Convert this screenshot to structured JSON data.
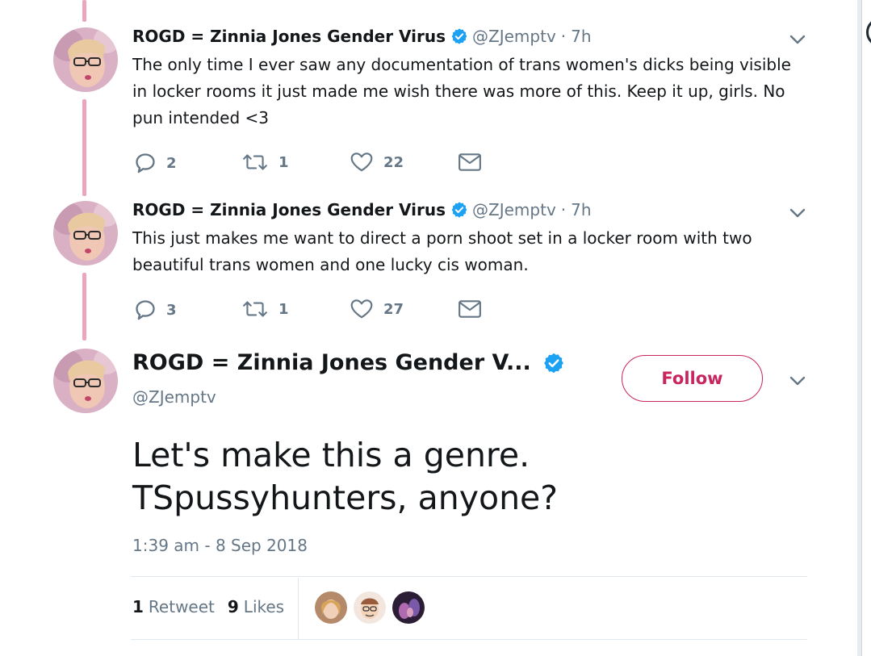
{
  "tweets": [
    {
      "name": "ROGD = Zinnia Jones Gender Virus",
      "handle": "@ZJemptv",
      "time": "7h",
      "text": "The only time I ever saw any documentation of trans women's dicks being visible in locker rooms it just made me wish there was more of this. Keep it up, girls. No pun intended <3",
      "replies": "2",
      "retweets": "1",
      "likes": "22"
    },
    {
      "name": "ROGD = Zinnia Jones Gender Virus",
      "handle": "@ZJemptv",
      "time": "7h",
      "text": "This just makes me want to direct a porn shoot set in a locker room with two beautiful trans women and one lucky cis woman.",
      "replies": "3",
      "retweets": "1",
      "likes": "27"
    }
  ],
  "main_tweet": {
    "name": "ROGD = Zinnia Jones Gender V...",
    "handle": "@ZJemptv",
    "follow_label": "Follow",
    "text": "Let's make this a genre. TSpussyhunters, anyone?",
    "timestamp": "1:39 am - 8 Sep 2018",
    "retweet_count": "1",
    "retweet_label": "Retweet",
    "like_count": "9",
    "like_label": "Likes"
  },
  "dot_separator": "·",
  "colors": {
    "accent": "#c8245e",
    "verified": "#1da1f2",
    "thread_line": "#eba6bd",
    "secondary_text": "#657786"
  },
  "icons": [
    "verified-badge-icon",
    "chevron-down-icon",
    "reply-icon",
    "retweet-icon",
    "like-icon",
    "message-icon"
  ]
}
